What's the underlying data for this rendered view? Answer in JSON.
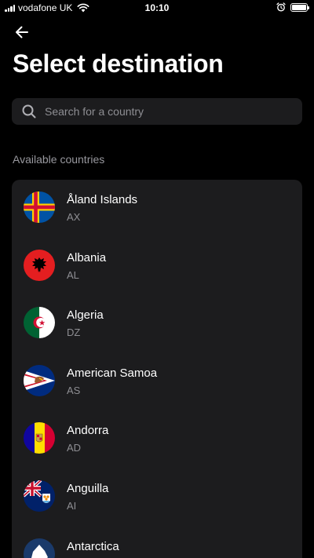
{
  "status_bar": {
    "carrier": "vodafone UK",
    "time": "10:10",
    "battery_level": 1.0
  },
  "header": {
    "back_icon": "arrow-left-icon",
    "title": "Select destination"
  },
  "search": {
    "placeholder": "Search for a country",
    "value": "",
    "icon": "search-icon"
  },
  "section": {
    "label": "Available countries"
  },
  "countries": [
    {
      "name": "Åland Islands",
      "code": "AX",
      "flag_icon": "flag-ax-icon"
    },
    {
      "name": "Albania",
      "code": "AL",
      "flag_icon": "flag-al-icon"
    },
    {
      "name": "Algeria",
      "code": "DZ",
      "flag_icon": "flag-dz-icon"
    },
    {
      "name": "American Samoa",
      "code": "AS",
      "flag_icon": "flag-as-icon"
    },
    {
      "name": "Andorra",
      "code": "AD",
      "flag_icon": "flag-ad-icon"
    },
    {
      "name": "Anguilla",
      "code": "AI",
      "flag_icon": "flag-ai-icon"
    },
    {
      "name": "Antarctica",
      "code": "",
      "flag_icon": "flag-aq-icon"
    }
  ],
  "colors": {
    "background": "#000000",
    "surface": "#1c1c1e",
    "secondary_text": "#8e8e93"
  }
}
